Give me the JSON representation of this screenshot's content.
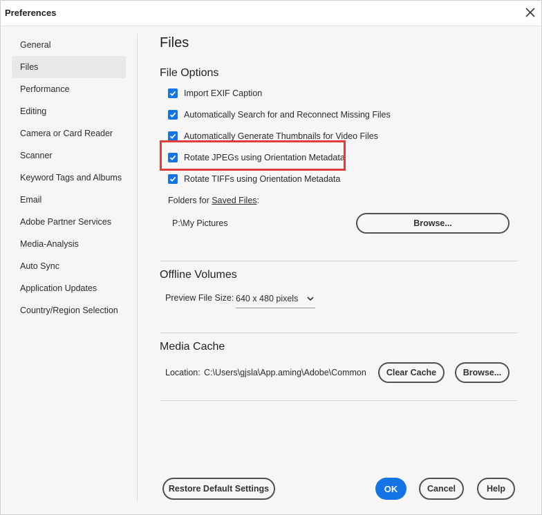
{
  "window": {
    "title": "Preferences"
  },
  "sidebar": {
    "items": [
      {
        "label": "General"
      },
      {
        "label": "Files",
        "selected": true
      },
      {
        "label": "Performance"
      },
      {
        "label": "Editing"
      },
      {
        "label": "Camera or Card Reader"
      },
      {
        "label": "Scanner"
      },
      {
        "label": "Keyword Tags and Albums"
      },
      {
        "label": "Email"
      },
      {
        "label": "Adobe Partner Services"
      },
      {
        "label": "Media-Analysis"
      },
      {
        "label": "Auto Sync"
      },
      {
        "label": "Application Updates"
      },
      {
        "label": "Country/Region Selection"
      }
    ]
  },
  "main": {
    "title": "Files",
    "file_options": {
      "heading": "File Options",
      "checkboxes": [
        {
          "label": "Import EXIF Caption",
          "checked": true
        },
        {
          "label": "Automatically Search for and Reconnect Missing Files",
          "checked": true
        },
        {
          "label": "Automatically Generate Thumbnails for Video Files",
          "checked": true
        },
        {
          "label": "Rotate JPEGs using Orientation Metadata",
          "checked": true
        },
        {
          "label": "Rotate TIFFs using Orientation Metadata",
          "checked": true
        }
      ],
      "folders_label_prefix": "Folders for ",
      "folders_label_link": "Saved Files",
      "folders_label_suffix": ":",
      "folder_path": "P:\\My Pictures",
      "browse_label": "Browse..."
    },
    "offline_volumes": {
      "heading": "Offline Volumes",
      "preview_label": "Preview File Size:",
      "preview_value": "640 x 480 pixels"
    },
    "media_cache": {
      "heading": "Media Cache",
      "location_label": "Location:",
      "location_value": "C:\\Users\\gjsla\\App.aming\\Adobe\\Common",
      "clear_cache_label": "Clear Cache",
      "browse_label": "Browse..."
    }
  },
  "footer": {
    "restore_label": "Restore Default Settings",
    "ok_label": "OK",
    "cancel_label": "Cancel",
    "help_label": "Help"
  },
  "colors": {
    "accent": "#1473e6",
    "highlight": "#e23d3d"
  }
}
